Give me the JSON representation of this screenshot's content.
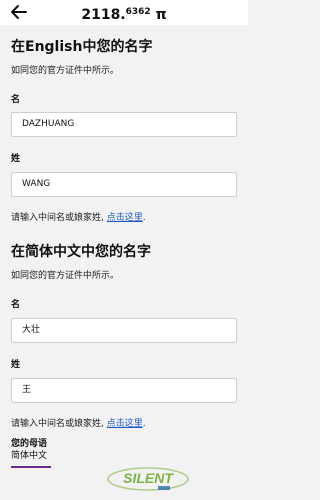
{
  "header": {
    "balance_main": "2118.",
    "balance_decimal": "6362",
    "currency_symbol": "π"
  },
  "english_section": {
    "title": "在English中您的名字",
    "hint": "如同您的官方证件中所示。",
    "first_name_label": "名",
    "first_name_value": "DAZHUANG",
    "last_name_label": "姓",
    "last_name_value": "WANG",
    "middle_name_text": "请输入中间名或娘家姓, ",
    "middle_name_link": "点击这里",
    "middle_name_end": "."
  },
  "chinese_section": {
    "title": "在简体中文中您的名字",
    "hint": "如同您的官方证件中所示。",
    "first_name_label": "名",
    "first_name_value": "大壮",
    "last_name_label": "姓",
    "last_name_value": "王",
    "middle_name_text": "请输入中间名或娘家姓, ",
    "middle_name_link": "点击这里",
    "middle_name_end": "."
  },
  "language_section": {
    "title": "您的母语",
    "selected": "简体中文"
  },
  "watermark": {
    "text": "SILENT",
    "accent": "#7cb342",
    "secondary": "#2a6fb0"
  }
}
